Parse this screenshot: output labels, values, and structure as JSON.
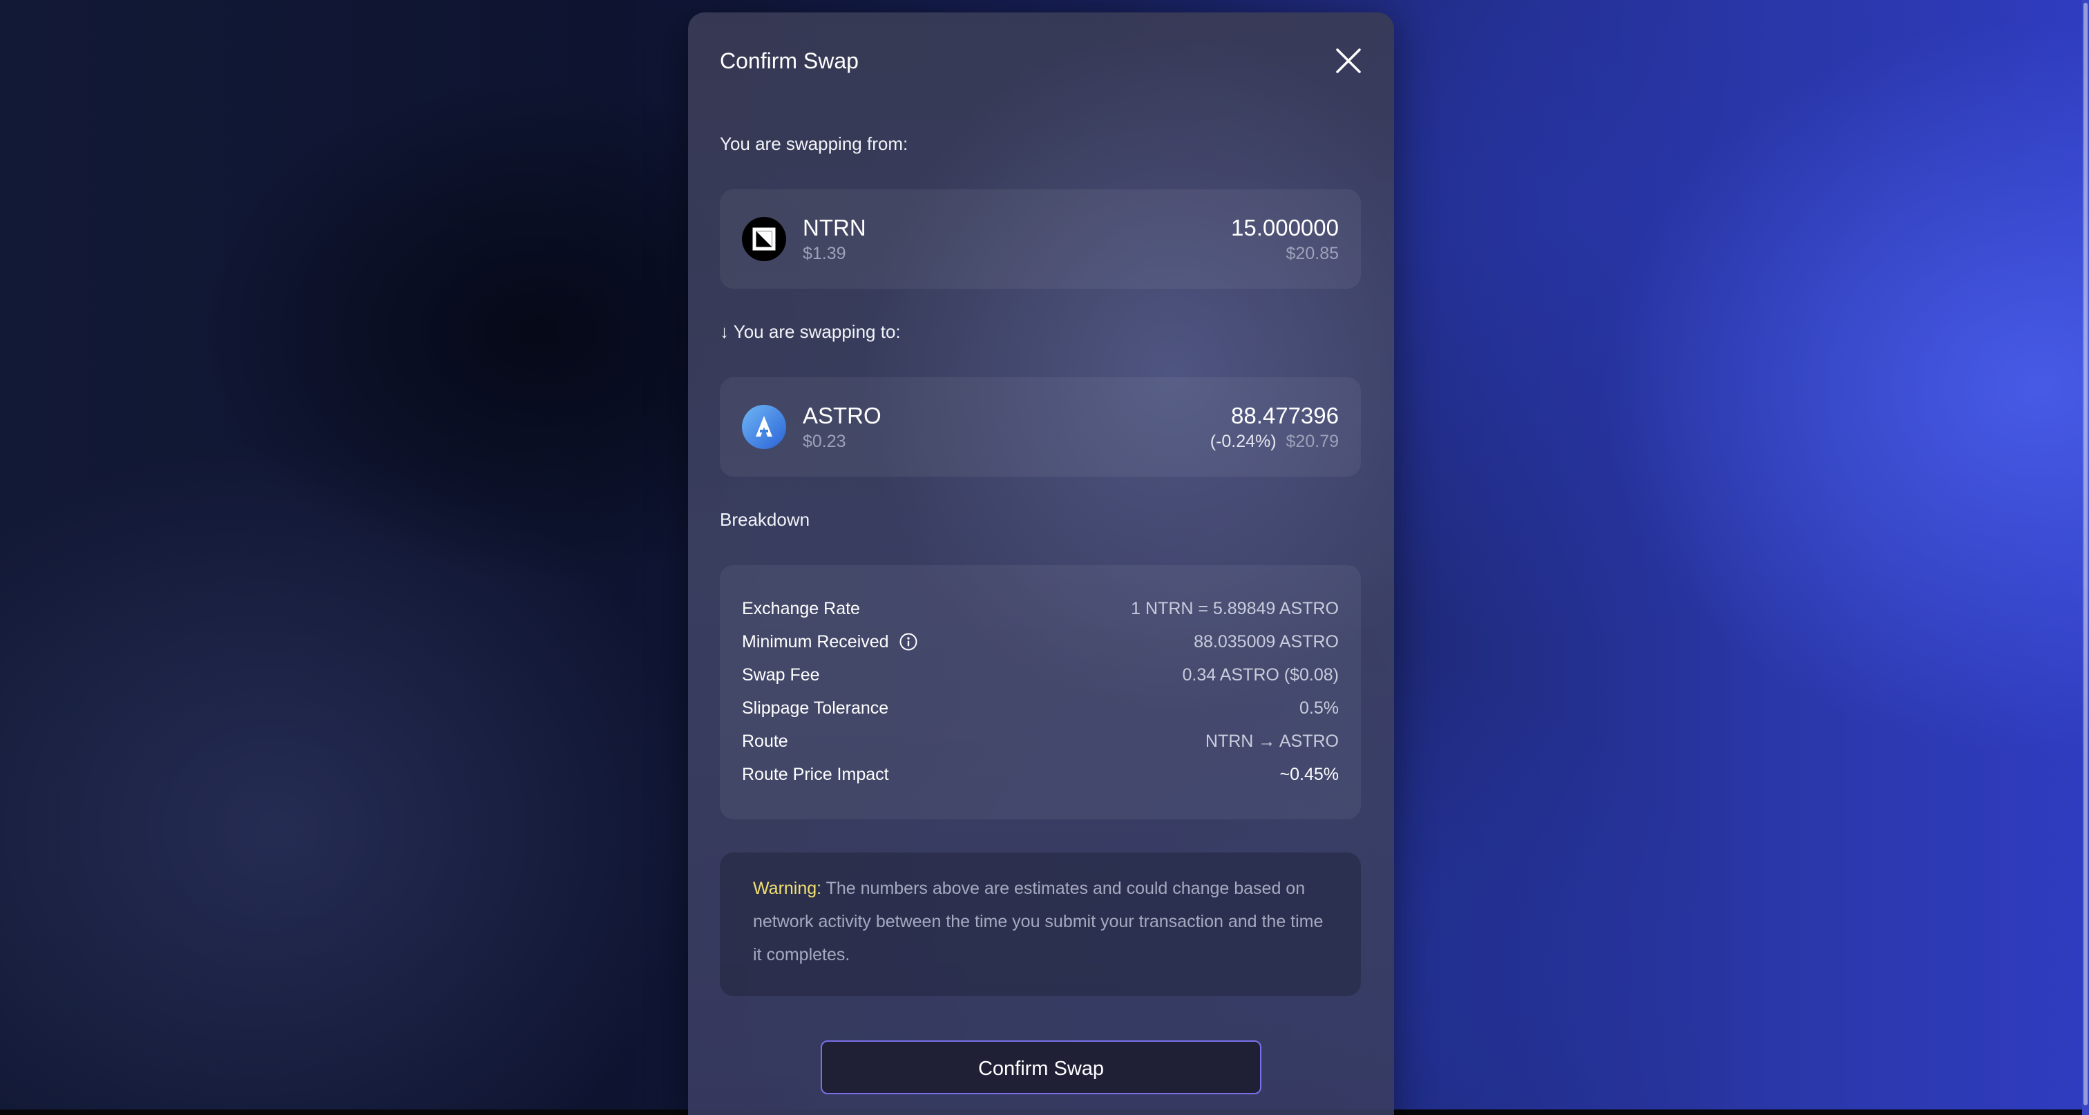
{
  "modal": {
    "title": "Confirm Swap",
    "close_icon": "close-icon"
  },
  "from": {
    "label": "You are swapping from:",
    "token": {
      "symbol": "NTRN",
      "price": "$1.39",
      "amount": "15.000000",
      "value": "$20.85",
      "icon": "ntrn-logo-icon"
    }
  },
  "to": {
    "label": "↓ You are swapping to:",
    "token": {
      "symbol": "ASTRO",
      "price": "$0.23",
      "amount": "88.477396",
      "price_change": "(-0.24%)",
      "value": "$20.79",
      "icon": "astro-logo-icon"
    }
  },
  "breakdown": {
    "title": "Breakdown",
    "rows": [
      {
        "label": "Exchange Rate",
        "value": "1 NTRN = 5.89849 ASTRO"
      },
      {
        "label": "Minimum Received",
        "value": "88.035009 ASTRO",
        "icon": "info-icon"
      },
      {
        "label": "Swap Fee",
        "value": "0.34 ASTRO ($0.08)"
      },
      {
        "label": "Slippage Tolerance",
        "value": "0.5%"
      },
      {
        "label": "Route",
        "value": "NTRN → ASTRO"
      },
      {
        "label": "Route Price Impact",
        "value": "~0.45%"
      }
    ]
  },
  "warning": {
    "label": "Warning:",
    "text": "The numbers above are estimates and could change based on network activity between the time you submit your transaction and the time it completes."
  },
  "confirm_button": {
    "label": "Confirm Swap"
  },
  "colors": {
    "warning_label": "#f2e06f",
    "button_border": "#7a6fe8",
    "muted_text": "#9da1b9"
  }
}
